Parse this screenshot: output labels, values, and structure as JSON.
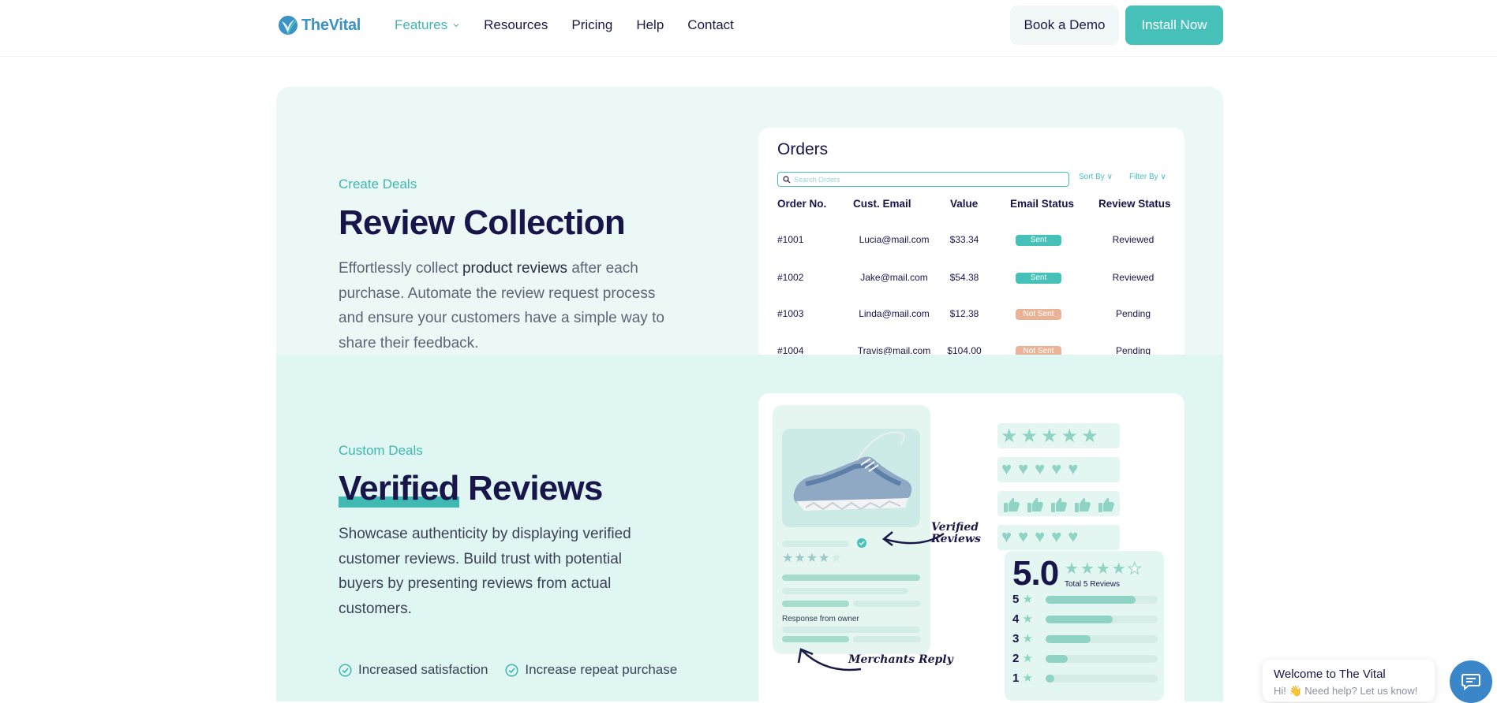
{
  "brand": {
    "name": "TheVital",
    "accent": "#45c1b9",
    "dark": "#17154a"
  },
  "nav": {
    "links": [
      {
        "label": "Features",
        "active": true,
        "has_dropdown": true
      },
      {
        "label": "Resources"
      },
      {
        "label": "Pricing"
      },
      {
        "label": "Help"
      },
      {
        "label": "Contact"
      }
    ],
    "demo_label": "Book a Demo",
    "install_label": "Install Now"
  },
  "section1": {
    "eyebrow": "Create Deals",
    "heading": "Review Collection",
    "para_start": "Effortlessly collect ",
    "para_bold": "product reviews",
    "para_end": " after each purchase. Automate the review request process and ensure your customers have a simple way to share their feedback."
  },
  "orders": {
    "title": "Orders",
    "search_placeholder": "Search Orders",
    "sort_label": "Sort By",
    "filter_label": "Filter By",
    "columns": [
      "Order No.",
      "Cust. Email",
      "Value",
      "Email Status",
      "Review Status"
    ],
    "rows": [
      {
        "order": "#1001",
        "email": "Lucia@mail.com",
        "value": "$33.34",
        "email_status": "Sent",
        "review_status": "Reviewed"
      },
      {
        "order": "#1002",
        "email": "Jake@mail.com",
        "value": "$54.38",
        "email_status": "Sent",
        "review_status": "Reviewed"
      },
      {
        "order": "#1003",
        "email": "Linda@mail.com",
        "value": "$12.38",
        "email_status": "Not Sent",
        "review_status": "Pending"
      },
      {
        "order": "#1004",
        "email": "Travis@mail.com",
        "value": "$104.00",
        "email_status": "Not Sent",
        "review_status": "Pending"
      }
    ]
  },
  "section2": {
    "eyebrow": "Custom Deals",
    "heading_highlight": "Verified",
    "heading_rest": " Reviews",
    "para": "Showcase authenticity by displaying verified customer reviews. Build trust with potential buyers by presenting reviews from actual customers.",
    "checks": [
      "Increased satisfaction",
      "Increase repeat purchase"
    ]
  },
  "reviews_widget": {
    "response_label": "Response from owner",
    "verified_line1": "Verified",
    "verified_line2": "Reviews",
    "merchants_reply": "Merchants Reply",
    "score": "5.0",
    "total_label": "Total 5 Reviews",
    "distribution": [
      {
        "stars": "5",
        "fill": 0.8
      },
      {
        "stars": "4",
        "fill": 0.6
      },
      {
        "stars": "3",
        "fill": 0.4
      },
      {
        "stars": "2",
        "fill": 0.2
      },
      {
        "stars": "1",
        "fill": 0.08
      }
    ]
  },
  "chat": {
    "title": "Welcome to The Vital",
    "subtitle": "Hi! 👋 Need help? Let us know!"
  }
}
